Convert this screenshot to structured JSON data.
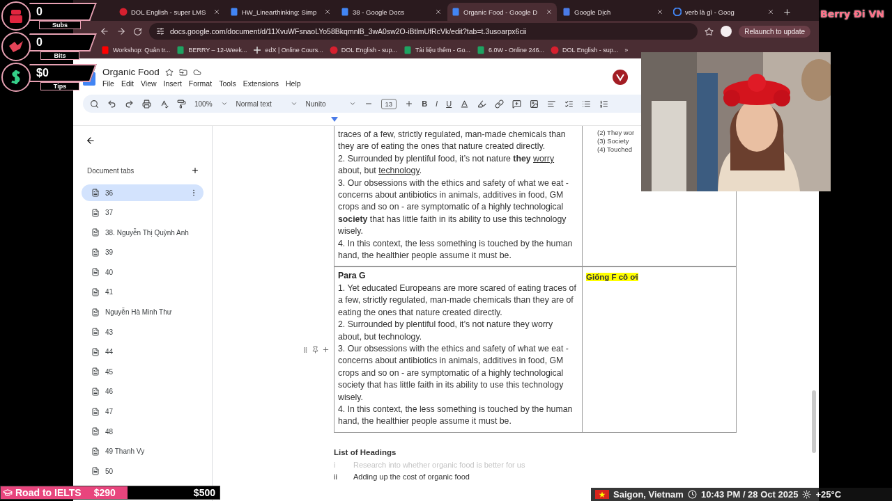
{
  "stream_counters": [
    {
      "kind": "subs",
      "value": "0",
      "label": "Subs"
    },
    {
      "kind": "bits",
      "value": "0",
      "label": "Bits"
    },
    {
      "kind": "tips",
      "value": "$0",
      "label": "Tips"
    }
  ],
  "stream_logo": "Berry Đi VN",
  "browser": {
    "tabs": [
      {
        "kind": "dol",
        "title": "DOL English - super LMS",
        "selected": false
      },
      {
        "kind": "docs",
        "title": "HW_Linearthinking: Simp",
        "selected": false
      },
      {
        "kind": "docs",
        "title": "38 - Google Docs",
        "selected": false
      },
      {
        "kind": "docs",
        "title": "Organic Food - Google D",
        "selected": true
      },
      {
        "kind": "translate",
        "title": "Google Dịch",
        "selected": false
      },
      {
        "kind": "google",
        "title": "verb là gì - Goog",
        "selected": false
      }
    ],
    "url": "docs.google.com/document/d/11XvuWFsnaoLYo58BkqmnlB_3wA0sw2O-iBtlmUfRcVk/edit?tab=t.3usoarpx6cii",
    "relaunch_button": "Relaunch to update",
    "bookmarks": [
      {
        "kind": "youtube",
        "title": "Workshop: Quản tr..."
      },
      {
        "kind": "sheets",
        "title": "BERRY – 12-Week..."
      },
      {
        "kind": "edx",
        "title": "edX | Online Cours..."
      },
      {
        "kind": "dol",
        "title": "DOL English - sup..."
      },
      {
        "kind": "sheets",
        "title": "Tài liệu thêm - Go..."
      },
      {
        "kind": "sheets",
        "title": "6.0W - Online 246..."
      },
      {
        "kind": "dol",
        "title": "DOL English - sup..."
      }
    ],
    "more_bookmarks": "»"
  },
  "document": {
    "title": "Organic Food",
    "menu": [
      "File",
      "Edit",
      "View",
      "Insert",
      "Format",
      "Tools",
      "Extensions",
      "Help"
    ],
    "toolbar": {
      "zoom": "100%",
      "style": "Normal text",
      "font": "Nunito",
      "font_size": "13",
      "bold": "B",
      "italic": "I",
      "underline": "U"
    },
    "sidebar": {
      "title": "Document tabs",
      "items": [
        {
          "label": "36",
          "selected": true
        },
        {
          "label": "37",
          "selected": false
        },
        {
          "label": "38. Nguyễn Thị Quỳnh Anh",
          "selected": false
        },
        {
          "label": "39",
          "selected": false
        },
        {
          "label": "40",
          "selected": false
        },
        {
          "label": "41",
          "selected": false
        },
        {
          "label": "Nguyễn Hà Minh Thư",
          "selected": false
        },
        {
          "label": "43",
          "selected": false
        },
        {
          "label": "44",
          "selected": false
        },
        {
          "label": "45",
          "selected": false
        },
        {
          "label": "46",
          "selected": false
        },
        {
          "label": "47",
          "selected": false
        },
        {
          "label": "48",
          "selected": false
        },
        {
          "label": "49 Thanh Vy",
          "selected": false
        },
        {
          "label": "50",
          "selected": false
        }
      ]
    },
    "table_rows": [
      {
        "heading": null,
        "paragraphs": [
          "traces of a few, strictly regulated, man-made chemicals than they are of eating the ones that nature created directly.",
          [
            {
              "text": "2. Surrounded by plentiful food, it’s not nature ",
              "kind": "plain"
            },
            {
              "text": "they ",
              "kind": "bold"
            },
            {
              "text": "worry",
              "kind": "underline"
            },
            {
              "text": " about, but ",
              "kind": "plain"
            },
            {
              "text": "technology",
              "kind": "underline"
            },
            {
              "text": ".",
              "kind": "plain"
            }
          ],
          "3. Our obsessions with the ethics and safety of what we eat - concerns about antibiotics in animals, additives in food, GM crops and so on - are symptomatic of a highly technological **society** that has little faith in its ability to use this technology wisely.",
          "4. In this context, the less something is touched by the human hand, the healthier people assume it must be."
        ],
        "notes": [
          "(2) They wor",
          "(3) Society",
          "(4) Touched"
        ],
        "comment": null
      },
      {
        "heading": "Para G",
        "paragraphs": [
          "1. Yet educated Europeans are more scared of eating traces of a few, strictly regulated, man-made chemicals than they are of eating the ones that nature created directly.",
          "2. Surrounded by plentiful food, it’s not nature they worry about, but technology.",
          "3. Our obsessions with the ethics and safety of what we eat - concerns about antibiotics in animals, additives in food, GM crops and so on - are symptomatic of a highly technological society that has little faith in its ability to use this technology wisely.",
          "4. In this context, the less something is touched by the human hand, the healthier people assume it must be."
        ],
        "notes": [],
        "comment": "Giống F cô ơi"
      }
    ],
    "list_title": "List of Headings",
    "headings": [
      {
        "numeral": "i",
        "text": "Research into whether organic food is better for us",
        "faded": true
      },
      {
        "numeral": "ii",
        "text": "Adding up the cost of organic food",
        "faded": false
      }
    ]
  },
  "goal_bar": {
    "label": "Road to IELTS",
    "raised": "$290",
    "target": "$500",
    "level": 0.58
  },
  "info_bar": {
    "location": "Saigon, Vietnam",
    "time": "10:43 PM / 28 Oct 2025",
    "weather": "+25°C"
  }
}
